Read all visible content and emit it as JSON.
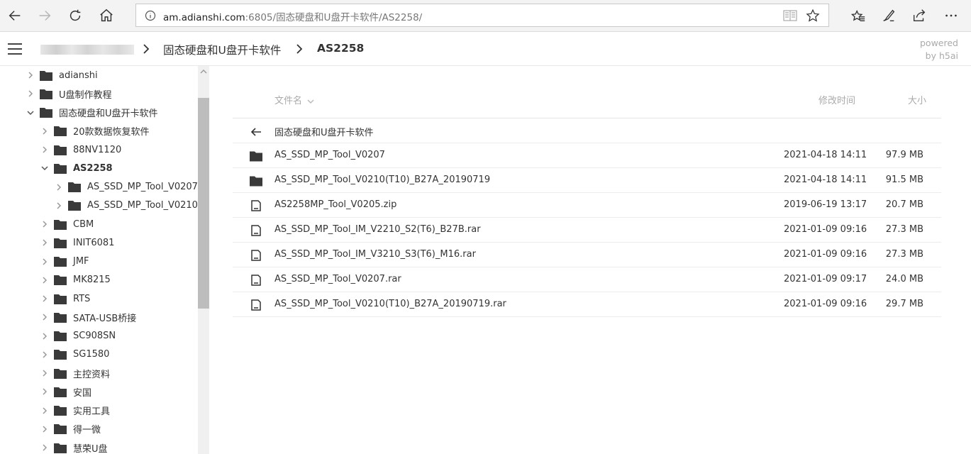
{
  "browser": {
    "url_host": "am.adianshi.com",
    "url_rest": ":6805/固态硬盘和U盘开卡软件/AS2258/"
  },
  "topbar": {
    "crumbs": [
      "固态硬盘和U盘开卡软件",
      "AS2258"
    ],
    "powered_line1": "powered",
    "powered_line2": "by h5ai"
  },
  "sidebar": {
    "items": [
      {
        "label": "adianshi",
        "level": 0,
        "expanded": false
      },
      {
        "label": "U盘制作教程",
        "level": 0,
        "expanded": false
      },
      {
        "label": "固态硬盘和U盘开卡软件",
        "level": 0,
        "expanded": true
      },
      {
        "label": "20款数据恢复软件",
        "level": 1,
        "expanded": false
      },
      {
        "label": "88NV1120",
        "level": 1,
        "expanded": false
      },
      {
        "label": "AS2258",
        "level": 1,
        "expanded": true,
        "current": true
      },
      {
        "label": "AS_SSD_MP_Tool_V0207",
        "level": 2,
        "expanded": false
      },
      {
        "label": "AS_SSD_MP_Tool_V0210(",
        "level": 2,
        "expanded": false
      },
      {
        "label": "CBM",
        "level": 1,
        "expanded": false
      },
      {
        "label": "INIT6081",
        "level": 1,
        "expanded": false
      },
      {
        "label": "JMF",
        "level": 1,
        "expanded": false
      },
      {
        "label": "MK8215",
        "level": 1,
        "expanded": false
      },
      {
        "label": "RTS",
        "level": 1,
        "expanded": false
      },
      {
        "label": "SATA-USB桥接",
        "level": 1,
        "expanded": false
      },
      {
        "label": "SC908SN",
        "level": 1,
        "expanded": false
      },
      {
        "label": "SG1580",
        "level": 1,
        "expanded": false
      },
      {
        "label": "主控资料",
        "level": 1,
        "expanded": false
      },
      {
        "label": "安国",
        "level": 1,
        "expanded": false
      },
      {
        "label": "实用工具",
        "level": 1,
        "expanded": false
      },
      {
        "label": "得一微",
        "level": 1,
        "expanded": false
      },
      {
        "label": "慧荣U盘",
        "level": 1,
        "expanded": false
      }
    ]
  },
  "listing": {
    "headers": {
      "name": "文件名",
      "modified": "修改时间",
      "size": "大小"
    },
    "parent": "固态硬盘和U盘开卡软件",
    "rows": [
      {
        "type": "folder",
        "name": "AS_SSD_MP_Tool_V0207",
        "date": "2021-04-18 14:11",
        "size": "97.9 MB"
      },
      {
        "type": "folder",
        "name": "AS_SSD_MP_Tool_V0210(T10)_B27A_20190719",
        "date": "2021-04-18 14:11",
        "size": "91.5 MB"
      },
      {
        "type": "file",
        "name": "AS2258MP_Tool_V0205.zip",
        "date": "2019-06-19 13:17",
        "size": "20.7 MB"
      },
      {
        "type": "file",
        "name": "AS_SSD_MP_Tool_IM_V2210_S2(T6)_B27B.rar",
        "date": "2021-01-09 09:16",
        "size": "27.3 MB"
      },
      {
        "type": "file",
        "name": "AS_SSD_MP_Tool_IM_V3210_S3(T6)_M16.rar",
        "date": "2021-01-09 09:16",
        "size": "27.3 MB"
      },
      {
        "type": "file",
        "name": "AS_SSD_MP_Tool_V0207.rar",
        "date": "2021-01-09 09:17",
        "size": "24.0 MB"
      },
      {
        "type": "file",
        "name": "AS_SSD_MP_Tool_V0210(T10)_B27A_20190719.rar",
        "date": "2021-01-09 09:16",
        "size": "29.7 MB"
      }
    ]
  }
}
